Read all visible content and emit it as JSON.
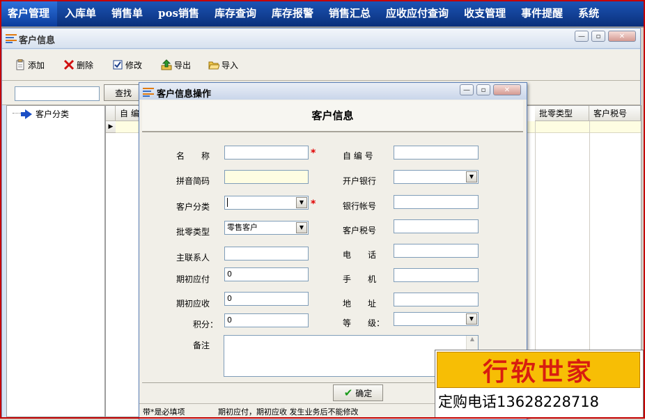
{
  "menu": {
    "items": [
      "客户管理",
      "入库单",
      "销售单",
      "pos销售",
      "库存查询",
      "库存报警",
      "销售汇总",
      "应收应付查询",
      "收支管理",
      "事件提醒",
      "系统"
    ]
  },
  "child_window": {
    "title": "客户信息",
    "toolbar": {
      "add": "添加",
      "delete": "删除",
      "edit": "修改",
      "export": "导出",
      "import": "导入"
    },
    "search": {
      "value": "",
      "button": "查找"
    },
    "tree": {
      "root": "客户分类"
    },
    "grid": {
      "columns": [
        "自 编",
        "批零类型",
        "客户税号"
      ]
    }
  },
  "dialog": {
    "title": "客户信息操作",
    "header": "客户信息",
    "left": {
      "name_label": "名　　称",
      "pinyin_label": "拼音简码",
      "category_label": "客户分类",
      "pricetype_label": "批零类型",
      "pricetype_value": "零售客户",
      "contact_label": "主联系人",
      "payable_label": "期初应付",
      "payable_value": "0",
      "receivable_label": "期初应收",
      "receivable_value": "0",
      "points_label": "积分：",
      "points_value": "0",
      "remark_label": "备注"
    },
    "right": {
      "code_label": "自 编 号",
      "bank_label": "开户银行",
      "account_label": "银行帐号",
      "taxno_label": "客户税号",
      "phone_label": "电　　话",
      "mobile_label": "手　　机",
      "address_label": "地　　址",
      "level_label": "等　　级："
    },
    "ok_button": "确定",
    "status_left": "带*是必填项",
    "status_right": "期初应付，期初应收 发生业务后不能修改"
  },
  "ad": {
    "title": "行软世家",
    "phone": "定购电话13628228718"
  },
  "colors": {
    "menu_bg": "#0a2f7a",
    "required_mark": "#e00000",
    "ad_bg": "#f7be05",
    "ad_text": "#d81d10",
    "frame": "#c40000"
  }
}
